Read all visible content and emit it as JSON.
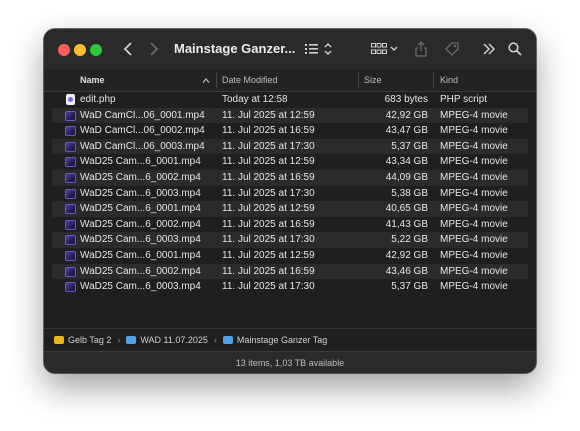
{
  "window": {
    "title": "Mainstage Ganzer...",
    "colors": {
      "background": "#1f1f1f",
      "toolbar": "#2a2a2a",
      "close": "#ff5f57",
      "minimize": "#febc2e",
      "zoom": "#28c840"
    }
  },
  "toolbar": {
    "back_icon": "chevron-left-icon",
    "forward_icon": "chevron-right-icon",
    "list_view_icon": "list-icon",
    "grouping_icon": "grid-icon",
    "share_icon": "share-icon",
    "tag_icon": "tag-icon",
    "more_icon": "double-chevron-right-icon",
    "search_icon": "search-icon"
  },
  "columns": {
    "name": "Name",
    "date": "Date Modified",
    "size": "Size",
    "kind": "Kind"
  },
  "files": [
    {
      "name": "edit.php",
      "date": "Today at 12:58",
      "size": "683 bytes",
      "kind": "PHP script",
      "icon": "php-file-icon"
    },
    {
      "name": "WaD CamCl...06_0001.mp4",
      "date": "11. Jul 2025 at 12:59",
      "size": "42,92 GB",
      "kind": "MPEG-4 movie",
      "icon": "movie-file-icon"
    },
    {
      "name": "WaD CamCl...06_0002.mp4",
      "date": "11. Jul 2025 at 16:59",
      "size": "43,47 GB",
      "kind": "MPEG-4 movie",
      "icon": "movie-file-icon"
    },
    {
      "name": "WaD CamCl...06_0003.mp4",
      "date": "11. Jul 2025 at 17:30",
      "size": "5,37 GB",
      "kind": "MPEG-4 movie",
      "icon": "movie-file-icon"
    },
    {
      "name": "WaD25 Cam...6_0001.mp4",
      "date": "11. Jul 2025 at 12:59",
      "size": "43,34 GB",
      "kind": "MPEG-4 movie",
      "icon": "movie-file-icon"
    },
    {
      "name": "WaD25 Cam...6_0002.mp4",
      "date": "11. Jul 2025 at 16:59",
      "size": "44,09 GB",
      "kind": "MPEG-4 movie",
      "icon": "movie-file-icon"
    },
    {
      "name": "WaD25 Cam...6_0003.mp4",
      "date": "11. Jul 2025 at 17:30",
      "size": "5,38 GB",
      "kind": "MPEG-4 movie",
      "icon": "movie-file-icon"
    },
    {
      "name": "WaD25 Cam...6_0001.mp4",
      "date": "11. Jul 2025 at 12:59",
      "size": "40,65 GB",
      "kind": "MPEG-4 movie",
      "icon": "movie-file-icon"
    },
    {
      "name": "WaD25 Cam...6_0002.mp4",
      "date": "11. Jul 2025 at 16:59",
      "size": "41,43 GB",
      "kind": "MPEG-4 movie",
      "icon": "movie-file-icon"
    },
    {
      "name": "WaD25 Cam...6_0003.mp4",
      "date": "11. Jul 2025 at 17:30",
      "size": "5,22 GB",
      "kind": "MPEG-4 movie",
      "icon": "movie-file-icon"
    },
    {
      "name": "WaD25 Cam...6_0001.mp4",
      "date": "11. Jul 2025 at 12:59",
      "size": "42,92 GB",
      "kind": "MPEG-4 movie",
      "icon": "movie-file-icon"
    },
    {
      "name": "WaD25 Cam...6_0002.mp4",
      "date": "11. Jul 2025 at 16:59",
      "size": "43,46 GB",
      "kind": "MPEG-4 movie",
      "icon": "movie-file-icon"
    },
    {
      "name": "WaD25 Cam...6_0003.mp4",
      "date": "11. Jul 2025 at 17:30",
      "size": "5,37 GB",
      "kind": "MPEG-4 movie",
      "icon": "movie-file-icon"
    }
  ],
  "pathbar": {
    "items": [
      {
        "label": "Gelb Tag 2",
        "icon": "drive-icon",
        "color": "#e8b71a"
      },
      {
        "label": "WAD 11.07.2025",
        "icon": "folder-icon",
        "color": "#4fa2e8"
      },
      {
        "label": "Mainstage Ganzer Tag",
        "icon": "folder-icon",
        "color": "#4fa2e8"
      }
    ]
  },
  "status": {
    "text": "13 items, 1,03 TB available"
  }
}
